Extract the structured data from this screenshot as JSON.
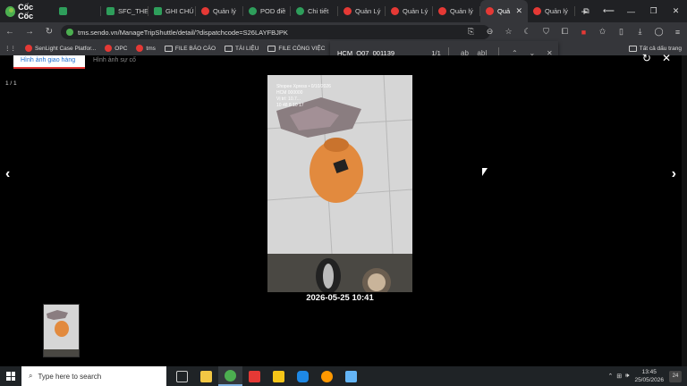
{
  "browser": {
    "logo_text": "Cốc Cốc",
    "tabs": [
      {
        "label": "",
        "favicon": "green-square"
      },
      {
        "label": "SFC_THE",
        "favicon": "green-square"
      },
      {
        "label": "GHI CHÚ",
        "favicon": "green-square"
      },
      {
        "label": "Quản lý",
        "favicon": "red-circle"
      },
      {
        "label": "POD điề",
        "favicon": "green-circle"
      },
      {
        "label": "Chi tiết",
        "favicon": "green-circle"
      },
      {
        "label": "Quản Lý",
        "favicon": "red-circle"
      },
      {
        "label": "Quản Lý",
        "favicon": "red-circle"
      },
      {
        "label": "Quản lý",
        "favicon": "red-circle"
      },
      {
        "label": "Quả",
        "favicon": "red-circle",
        "active": true
      },
      {
        "label": "Quản lý",
        "favicon": "red-circle"
      }
    ],
    "url": "tms.sendo.vn/ManageTripShuttle/detail/?dispatchcode=S26LAYFBJPK",
    "bookmarks": [
      {
        "label": "SenLight Case Platfor...",
        "icon": "red-circle"
      },
      {
        "label": "OPC",
        "icon": "red-circle"
      },
      {
        "label": "tms",
        "icon": "red-circle"
      },
      {
        "label": "FILE BÁO CÁO",
        "icon": "folder"
      },
      {
        "label": "TÀI LIỆU",
        "icon": "folder"
      },
      {
        "label": "FILE CÔNG VIỆC",
        "icon": "folder"
      }
    ],
    "all_bookmarks_label": "Tất cả dấu trang"
  },
  "find_bar": {
    "query": "HCM_Q07_001139",
    "count": "1/1"
  },
  "page": {
    "tabs": [
      {
        "label": "Hình ảnh giao hàng",
        "selected": true
      },
      {
        "label": "Hình ảnh sự cố",
        "selected": false
      }
    ],
    "image_counter": "1 / 1",
    "image_caption": "2026-05-25 10:41",
    "photo_overlay": [
      "Shopee Xpress • 0/10/2026",
      "HCM 000000",
      "Vị trí: 10.7...",
      "10 48 8 10 17"
    ]
  },
  "taskbar": {
    "search_placeholder": "Type here to search",
    "time": "13:45",
    "date": "25/05/2026",
    "notification_count": "24"
  },
  "colors": {
    "accent": "#e53935",
    "link_blue": "#1d6fd2",
    "tab_bg": "#202124"
  }
}
